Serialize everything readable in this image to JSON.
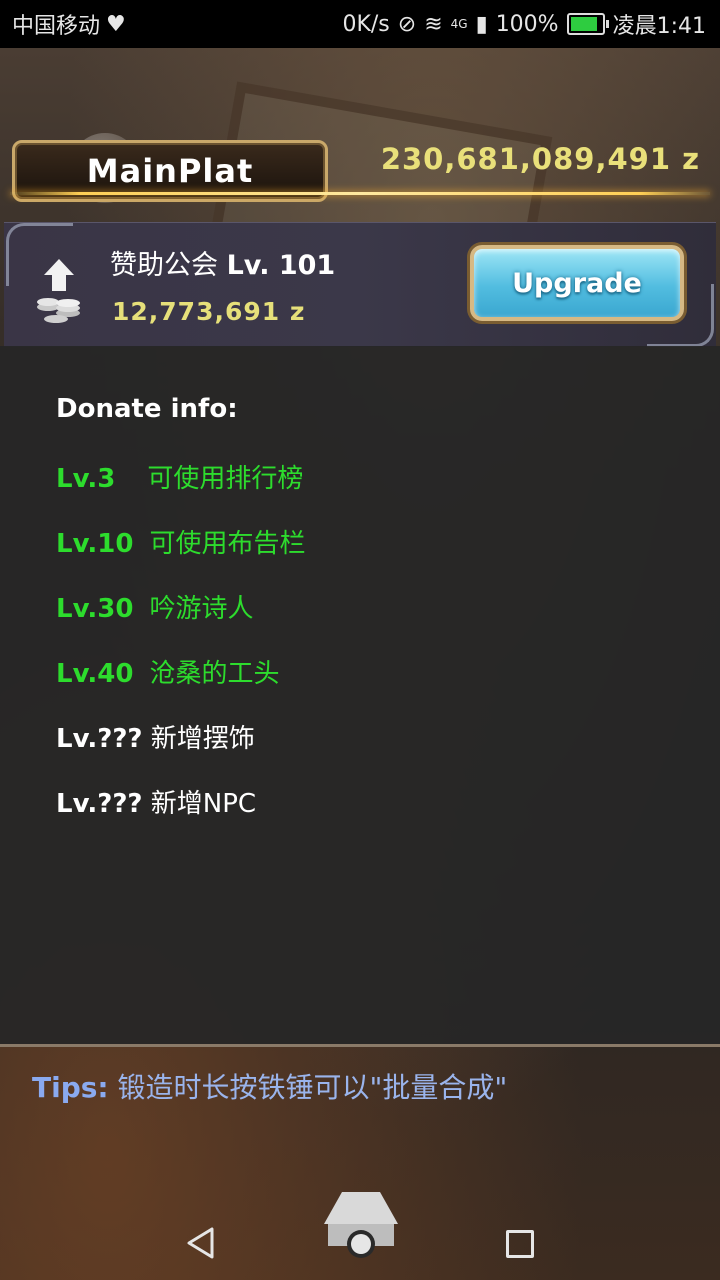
{
  "status_bar": {
    "carrier": "中国移动",
    "speed": "0K/s",
    "network": "4G",
    "battery": "100%",
    "battery_level": 1.0,
    "time": "凌晨1:41"
  },
  "header": {
    "title": "MainPlat",
    "total_money": "230,681,089,491 z"
  },
  "guild": {
    "name": "赞助公会",
    "level": "Lv. 101",
    "cost": "12,773,691 z",
    "upgrade_label": "Upgrade"
  },
  "donate": {
    "title": "Donate info:",
    "items": [
      {
        "level": "Lv.3",
        "text": "可使用排行榜"
      },
      {
        "level": "Lv.10",
        "text": "可使用布告栏"
      },
      {
        "level": "Lv.30",
        "text": "吟游诗人"
      },
      {
        "level": "Lv.40",
        "text": "沧桑的工头"
      },
      {
        "level": "Lv.???",
        "text": "新增摆饰"
      },
      {
        "level": "Lv.???",
        "text": "新增NPC"
      }
    ]
  },
  "tips": {
    "label": "Tips:",
    "text": "锻造时长按铁锤可以\"批量合成\""
  },
  "colors": {
    "unlocked": "#2ddc2d",
    "locked": "#ffffff",
    "gold": "#e9e07a",
    "tips": "#8aaaf0"
  },
  "icons": {
    "coin": "coin-stack-upgrade-icon",
    "back": "back-triangle-icon",
    "home": "home-icon",
    "recent": "recent-apps-icon"
  }
}
